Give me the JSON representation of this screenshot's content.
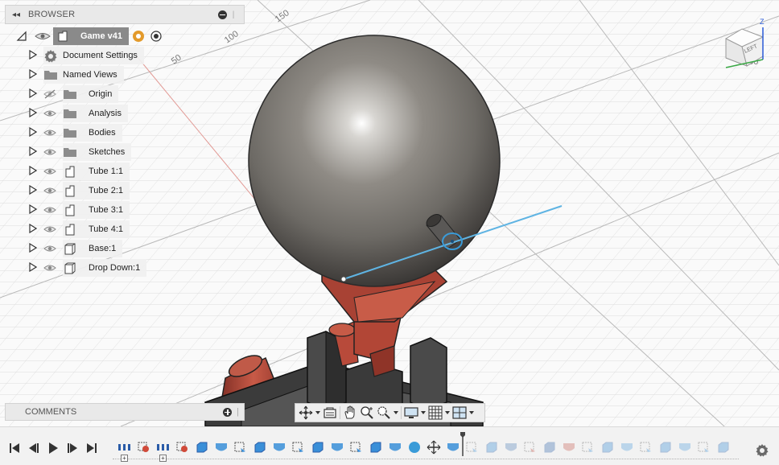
{
  "browser": {
    "title": "BROWSER",
    "root": {
      "label": "Game v41"
    },
    "items": [
      {
        "label": "Document Settings",
        "icon": "gear-icon"
      },
      {
        "label": "Named Views",
        "icon": "folder-icon"
      },
      {
        "label": "Origin",
        "icon": "folder-icon",
        "hidden": true
      },
      {
        "label": "Analysis",
        "icon": "folder-icon"
      },
      {
        "label": "Bodies",
        "icon": "folder-icon"
      },
      {
        "label": "Sketches",
        "icon": "folder-icon"
      },
      {
        "label": "Tube 1:1",
        "icon": "component-icon"
      },
      {
        "label": "Tube 2:1",
        "icon": "component-icon"
      },
      {
        "label": "Tube 3:1",
        "icon": "component-icon"
      },
      {
        "label": "Tube 4:1",
        "icon": "component-icon"
      },
      {
        "label": "Base:1",
        "icon": "box-component-icon"
      },
      {
        "label": "Drop Down:1",
        "icon": "box-component-icon"
      }
    ]
  },
  "comments": {
    "title": "COMMENTS"
  },
  "viewport": {
    "grid_labels": [
      "150",
      "100",
      "50",
      "450"
    ],
    "viewcube": {
      "face_label": "LEFT",
      "axis_label": "Z"
    }
  },
  "navbar": {
    "tools": [
      "orbit-icon",
      "look-at-icon",
      "pan-icon",
      "zoom-icon",
      "fit-icon",
      "display-settings-icon",
      "grid-settings-icon",
      "viewports-icon"
    ]
  },
  "timeline": {
    "controls": [
      "go-to-start-icon",
      "step-back-icon",
      "play-icon",
      "step-forward-icon",
      "go-to-end-icon"
    ]
  },
  "colors": {
    "accent_blue": "#3a9bd8",
    "part_red": "#b84a3a",
    "panel_gray": "#e9e9e9"
  }
}
